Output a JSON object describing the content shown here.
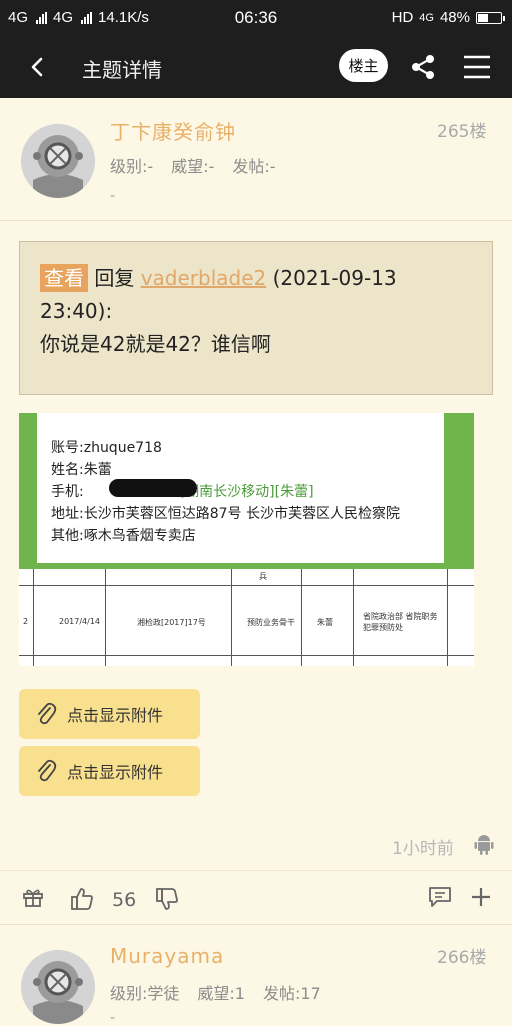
{
  "status_bar": {
    "sig1": "4G",
    "sig2": "4G",
    "speed": "14.1K/s",
    "time": "06:36",
    "hd": "HD",
    "net": "4G",
    "battery": "48%",
    "battery_level": 0.48
  },
  "header": {
    "title": "主题详情",
    "op_label": "楼主"
  },
  "post1": {
    "username": "丁卞康癸俞钟",
    "floor": "265楼",
    "level": "级别:-",
    "prestige": "威望:-",
    "posts": "发帖:-",
    "extra": "-",
    "quote": {
      "tag": "查看",
      "reply_prefix": "回复",
      "reply_user": "vaderblade2",
      "reply_time": "(2021-09-13 23:40):",
      "text": "你说是42就是42？谁信啊"
    },
    "image": {
      "account": "账号:zhuque718",
      "name": "姓名:朱蕾",
      "phone_label": "手机:",
      "phone_carrier": "[湖南长沙移动][朱蕾]",
      "address": "地址:长沙市芙蓉区恒达路87号  长沙市芙蓉区人民检察院",
      "other": "其他:啄木鸟香烟专卖店",
      "table_no": "2",
      "table_date": "2017/4/14",
      "table_doc": "湘检政[2017]17号",
      "table_col4": "预防业务骨干",
      "table_col5": "朱蕾",
      "table_col6": "省院政治部 省院职务犯罪预防处",
      "table_top": "兵"
    },
    "attachments": [
      "点击显示附件",
      "点击显示附件"
    ],
    "time": "1小时前",
    "likes": "56"
  },
  "post2": {
    "username": "Murayama",
    "floor": "266楼",
    "level": "级别:学徒",
    "prestige": "威望:1",
    "posts": "发帖:17",
    "extra": "-"
  },
  "icons": {
    "back": "chevron-left-icon",
    "share": "share-icon",
    "menu": "menu-icon",
    "attach": "paperclip-icon",
    "device": "android-icon",
    "gift": "gift-icon",
    "like": "thumbs-up-icon",
    "dislike": "thumbs-down-icon",
    "comment": "comment-icon",
    "add": "plus-icon"
  },
  "colors": {
    "background": "#fdf8e6",
    "header": "#1e1e1e",
    "username": "#e8b16a",
    "attach_button": "#f9e08e",
    "tag": "#e8a35c"
  }
}
